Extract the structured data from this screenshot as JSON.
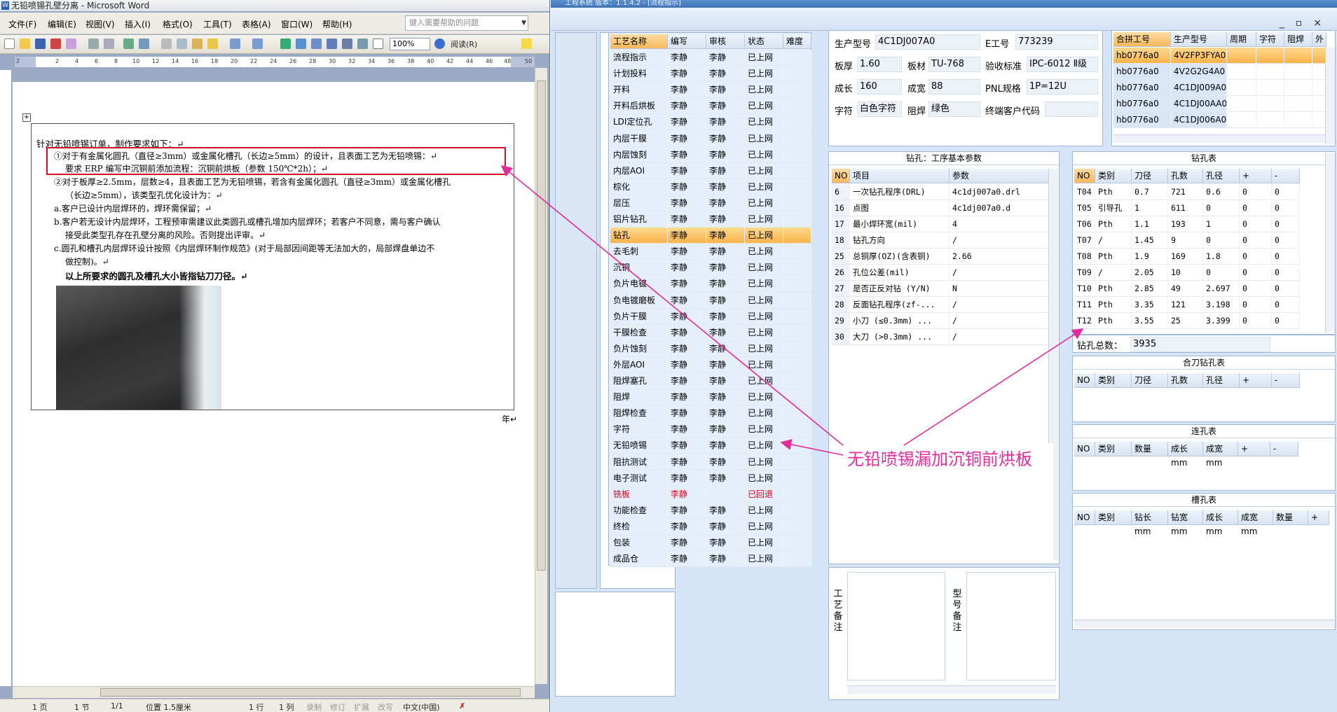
{
  "word": {
    "title": "无铅喷锡孔壁分离 - Microsoft Word",
    "menu": [
      "文件(F)",
      "编辑(E)",
      "视图(V)",
      "插入(I)",
      "格式(O)",
      "工具(T)",
      "表格(A)",
      "窗口(W)",
      "帮助(H)"
    ],
    "help_placeholder": "键入需要帮助的问题",
    "zoom": "100%",
    "read_label": "阅读(R)",
    "ruler_numbers": [
      "2",
      "2",
      "4",
      "6",
      "8",
      "10",
      "12",
      "14",
      "16",
      "18",
      "20",
      "22",
      "24",
      "26",
      "28",
      "30",
      "32",
      "34",
      "36",
      "38",
      "40",
      "42",
      "44",
      "46",
      "48",
      "50"
    ],
    "doc_lines": [
      "针对无铅喷锡订单，制作要求如下：↵",
      "①对于有金属化圆孔（直径≥3mm）或金属化槽孔（长边≥5mm）的设计，且表面工艺为无铅喷锡：↵",
      "要求 ERP 编写中沉铜前添加流程：沉铜前烘板（参数 150℃*2h）；↵",
      "②对于板厚≥2.5mm，层数≥4，且表面工艺为无铅喷锡，若含有金属化圆孔（直径≥3mm）或金属化槽孔",
      "（长边≥5mm），该类型孔优化设计为：↵",
      "a.客户已设计内层焊环的，焊环需保留；↵",
      "b.客户若无设计内层焊环，工程预审需建议此类圆孔或槽孔增加内层焊环；若客户不同意，需与客户确认",
      "接受此类型孔存在孔壁分离的风险。否则提出评审。↵",
      "c.圆孔和槽孔内层焊环设计按照《内层焊环制作规范》(对于局部因间距等无法加大的，局部焊盘单边不",
      "做控制)。↵",
      "以上所要求的圆孔及槽孔大小皆指钻刀刀径。↵"
    ],
    "year_mark": "年↵",
    "status": {
      "page": "1 页",
      "section": "1 节",
      "pages": "1/1",
      "position": "位置 1.5厘米",
      "row": "1 行",
      "col": "1 列",
      "rec": "录制",
      "trk": "修订",
      "ext": "扩展",
      "ovr": "改写",
      "lang": "中文(中国)"
    }
  },
  "app": {
    "title": "工程系统   版本：1.1.4.2 - [流程指示]",
    "process_table": {
      "headers": [
        "工艺名称",
        "编写",
        "审核",
        "状态",
        "难度"
      ],
      "rows": [
        [
          "流程指示",
          "李静",
          "李静",
          "已上网",
          ""
        ],
        [
          "计划投料",
          "李静",
          "李静",
          "已上网",
          ""
        ],
        [
          "开料",
          "李静",
          "李静",
          "已上网",
          ""
        ],
        [
          "开料后烘板",
          "李静",
          "李静",
          "已上网",
          ""
        ],
        [
          "LDI定位孔",
          "李静",
          "李静",
          "已上网",
          ""
        ],
        [
          "内层干膜",
          "李静",
          "李静",
          "已上网",
          ""
        ],
        [
          "内层蚀刻",
          "李静",
          "李静",
          "已上网",
          ""
        ],
        [
          "内层AOI",
          "李静",
          "李静",
          "已上网",
          ""
        ],
        [
          "棕化",
          "李静",
          "李静",
          "已上网",
          ""
        ],
        [
          "层压",
          "李静",
          "李静",
          "已上网",
          ""
        ],
        [
          "铝片钻孔",
          "李静",
          "李静",
          "已上网",
          ""
        ],
        [
          "钻孔",
          "李静",
          "李静",
          "已上网",
          ""
        ],
        [
          "去毛刺",
          "李静",
          "李静",
          "已上网",
          ""
        ],
        [
          "沉铜",
          "李静",
          "李静",
          "已上网",
          ""
        ],
        [
          "负片电镀",
          "李静",
          "李静",
          "已上网",
          ""
        ],
        [
          "负电镀磨板",
          "李静",
          "李静",
          "已上网",
          ""
        ],
        [
          "负片干膜",
          "李静",
          "李静",
          "已上网",
          ""
        ],
        [
          "干膜检查",
          "李静",
          "李静",
          "已上网",
          ""
        ],
        [
          "负片蚀刻",
          "李静",
          "李静",
          "已上网",
          ""
        ],
        [
          "外层AOI",
          "李静",
          "李静",
          "已上网",
          ""
        ],
        [
          "阻焊塞孔",
          "李静",
          "李静",
          "已上网",
          ""
        ],
        [
          "阻焊",
          "李静",
          "李静",
          "已上网",
          ""
        ],
        [
          "阻焊检查",
          "李静",
          "李静",
          "已上网",
          ""
        ],
        [
          "字符",
          "李静",
          "李静",
          "已上网",
          ""
        ],
        [
          "无铅喷锡",
          "李静",
          "李静",
          "已上网",
          ""
        ],
        [
          "阻抗测试",
          "李静",
          "李静",
          "已上网",
          ""
        ],
        [
          "电子测试",
          "李静",
          "李静",
          "已上网",
          ""
        ],
        [
          "铣板",
          "李静",
          "",
          "已回退",
          ""
        ],
        [
          "功能检查",
          "李静",
          "李静",
          "已上网",
          ""
        ],
        [
          "终检",
          "李静",
          "李静",
          "已上网",
          ""
        ],
        [
          "包装",
          "李静",
          "李静",
          "已上网",
          ""
        ],
        [
          "成品仓",
          "李静",
          "李静",
          "已上网",
          ""
        ]
      ],
      "selected_index": 11,
      "rollback_index": 27
    },
    "info": {
      "prod_model_label": "生产型号",
      "prod_model": "4C1DJ007A0",
      "e_no_label": "E工号",
      "e_no": "773239",
      "thickness_label": "板厚",
      "thickness": "1.60",
      "material_label": "板材",
      "material": "TU-768",
      "accept_std_label": "验收标准",
      "accept_std": "IPC-6012 Ⅱ级",
      "length_label": "成长",
      "length": "160",
      "width_label": "成宽",
      "width": "88",
      "pnl_label": "PNL规格",
      "pnl": "1P=12U",
      "char_label": "字符",
      "char_color": "白色字符",
      "mask_label": "阻焊",
      "mask_color": "绿色",
      "end_customer_label": "终端客户代码",
      "end_customer": ""
    },
    "combo_table": {
      "headers": [
        "合拼工号",
        "生产型号",
        "周期",
        "字符",
        "阻焊",
        "外"
      ],
      "rows": [
        [
          "hb0776a0",
          "4V2FP3FYA0"
        ],
        [
          "hb0776a0",
          "4V2G2G4A0"
        ],
        [
          "hb0776a0",
          "4C1DJ009A0"
        ],
        [
          "hb0776a0",
          "4C1DJ00AA0"
        ],
        [
          "hb0776a0",
          "4C1DJ006A0"
        ]
      ]
    },
    "params": {
      "title": "钻孔：工序基本参数",
      "headers": [
        "NO",
        "项目",
        "参数"
      ],
      "rows": [
        [
          "6",
          "一次钻孔程序(DRL)",
          "4c1dj007a0.drl"
        ],
        [
          "16",
          "点图",
          "4c1dj007a0.d"
        ],
        [
          "17",
          "最小焊环宽(mil)",
          "4"
        ],
        [
          "18",
          "钻孔方向",
          "/"
        ],
        [
          "25",
          "总铜厚(OZ)(含表铜)",
          "2.66"
        ],
        [
          "26",
          "孔位公差(mil)",
          "/"
        ],
        [
          "27",
          "是否正反对钻 (Y/N)",
          "N"
        ],
        [
          "28",
          "反面钻孔程序(zf-...",
          "/"
        ],
        [
          "29",
          "小刀 (≤0.3mm) ...",
          "/"
        ],
        [
          "30",
          "大刀 (>0.3mm) ...",
          "/"
        ]
      ]
    },
    "drill": {
      "title": "钻孔表",
      "headers": [
        "NO",
        "类别",
        "刀径",
        "孔数",
        "孔径",
        "+",
        "-"
      ],
      "rows": [
        [
          "T04",
          "Pth",
          "0.7",
          "721",
          "0.6",
          "0",
          "0"
        ],
        [
          "T05",
          "引导孔",
          "1",
          "611",
          "0",
          "0",
          "0"
        ],
        [
          "T06",
          "Pth",
          "1.1",
          "193",
          "1",
          "0",
          "0"
        ],
        [
          "T07",
          "/",
          "1.45",
          "9",
          "0",
          "0",
          "0"
        ],
        [
          "T08",
          "Pth",
          "1.9",
          "169",
          "1.8",
          "0",
          "0"
        ],
        [
          "T09",
          "/",
          "2.05",
          "10",
          "0",
          "0",
          "0"
        ],
        [
          "T10",
          "Pth",
          "2.85",
          "49",
          "2.697",
          "0",
          "0"
        ],
        [
          "T11",
          "Pth",
          "3.35",
          "121",
          "3.198",
          "0",
          "0"
        ],
        [
          "T12",
          "Pth",
          "3.55",
          "25",
          "3.399",
          "0",
          "0"
        ]
      ],
      "total_label": "钻孔总数：",
      "total": "3935"
    },
    "combo_drill": {
      "title": "合刀钻孔表",
      "headers": [
        "NO",
        "类别",
        "刀径",
        "孔数",
        "孔径",
        "+",
        "-"
      ]
    },
    "link_hole": {
      "title": "连孔表",
      "headers": [
        "NO",
        "类别",
        "数量",
        "成长mm",
        "成宽mm",
        "+",
        "-"
      ]
    },
    "slot_hole": {
      "title": "槽孔表",
      "headers": [
        "NO",
        "类别",
        "钻长mm",
        "钻宽mm",
        "成长mm",
        "成宽mm",
        "数量",
        "+"
      ]
    },
    "remarks": {
      "process_label": "工艺备注",
      "model_label": "型号备注"
    }
  },
  "annotation": {
    "text": "无铅喷锡漏加沉铜前烘板",
    "color": "#e52b9b"
  },
  "colors": {
    "accent_selected": "#f8b34a",
    "red_box": "#d01020",
    "rollback_red": "#e0001c"
  }
}
